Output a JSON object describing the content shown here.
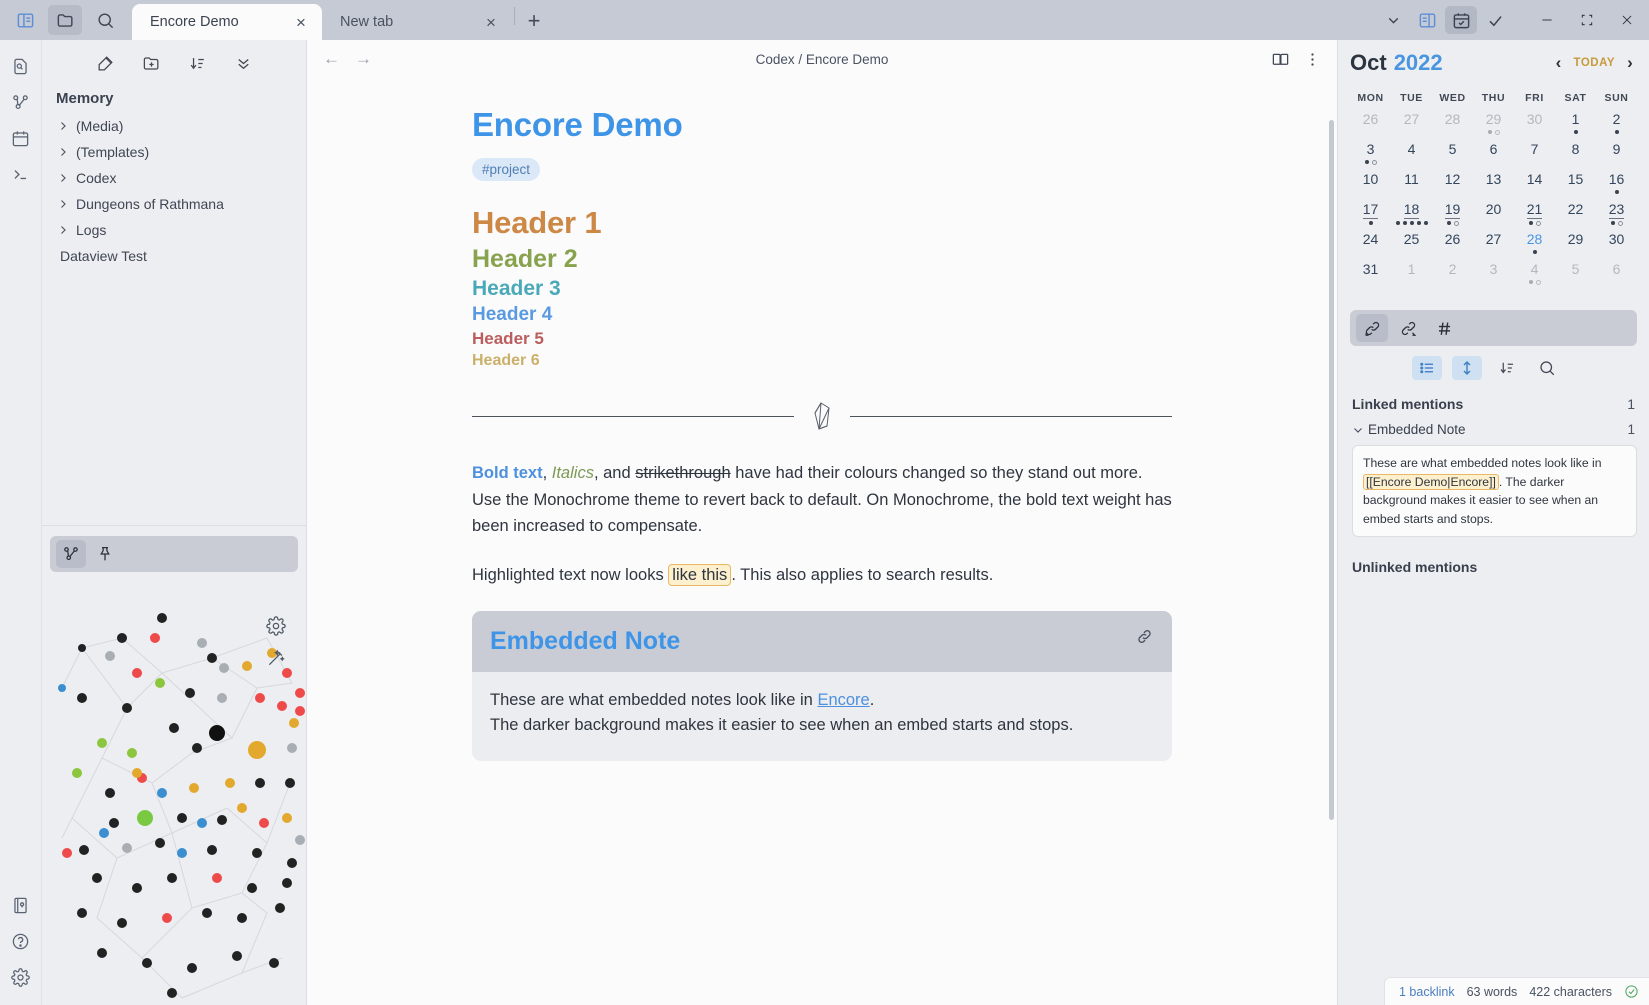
{
  "titlebar": {
    "left_icons": [
      {
        "name": "toggle-left-sidebar-icon",
        "glyph": "sidebar"
      },
      {
        "name": "vault-switcher-icon",
        "glyph": "folder"
      },
      {
        "name": "search-icon",
        "glyph": "search"
      }
    ],
    "tabs": [
      {
        "label": "Encore Demo",
        "active": true,
        "close": "×"
      },
      {
        "label": "New tab",
        "active": false,
        "close": "×"
      }
    ],
    "new_tab_glyph": "+",
    "right_icons": [
      {
        "name": "tab-list-chevron-icon",
        "glyph": "chevron-down"
      },
      {
        "name": "toggle-right-sidebar-icon",
        "glyph": "right-sidebar"
      },
      {
        "name": "calendar-plugin-icon",
        "glyph": "calendar-check",
        "active": true
      },
      {
        "name": "tasks-plugin-icon",
        "glyph": "check"
      }
    ],
    "window_controls": [
      {
        "name": "minimize-button",
        "glyph": "—"
      },
      {
        "name": "maximize-button",
        "glyph": "⬚"
      },
      {
        "name": "close-button",
        "glyph": "✕"
      }
    ]
  },
  "ribbon": {
    "top_items": [
      {
        "name": "quick-switcher-icon"
      },
      {
        "name": "graph-view-icon"
      },
      {
        "name": "calendar-icon"
      },
      {
        "name": "terminal-icon"
      }
    ],
    "bottom_items": [
      {
        "name": "vault-icon"
      },
      {
        "name": "help-icon"
      },
      {
        "name": "settings-icon"
      }
    ]
  },
  "sidebar": {
    "toolbar": [
      {
        "name": "new-note-icon"
      },
      {
        "name": "new-folder-icon"
      },
      {
        "name": "sort-order-icon"
      },
      {
        "name": "collapse-all-icon"
      }
    ],
    "vault_name": "Memory",
    "tree": [
      {
        "label": "(Media)",
        "folder": true
      },
      {
        "label": "(Templates)",
        "folder": true
      },
      {
        "label": "Codex",
        "folder": true
      },
      {
        "label": "Dungeons of Rathmana",
        "folder": true
      },
      {
        "label": "Logs",
        "folder": true
      },
      {
        "label": "Dataview Test",
        "folder": false
      }
    ],
    "graph_panel": {
      "tabs": [
        {
          "name": "local-graph-icon",
          "active": true
        },
        {
          "name": "pin-icon",
          "active": false
        }
      ],
      "controls": [
        {
          "name": "graph-settings-gear-icon"
        },
        {
          "name": "graph-style-wand-icon"
        }
      ]
    }
  },
  "note": {
    "nav": {
      "back": "←",
      "forward": "→"
    },
    "breadcrumb": "Codex / Encore Demo",
    "header_icons": [
      {
        "name": "reading-view-icon"
      },
      {
        "name": "more-options-icon"
      }
    ],
    "title": "Encore Demo",
    "tag": "#project",
    "headers": [
      {
        "level": 1,
        "text": "Header 1"
      },
      {
        "level": 2,
        "text": "Header 2"
      },
      {
        "level": 3,
        "text": "Header 3"
      },
      {
        "level": 4,
        "text": "Header 4"
      },
      {
        "level": 5,
        "text": "Header 5"
      },
      {
        "level": 6,
        "text": "Header 6"
      }
    ],
    "paragraph1": {
      "bold": "Bold text",
      "sep1": ", ",
      "italic": "Italics",
      "sep2": ", and ",
      "strike": "strikethrough",
      "rest": " have had their colours changed so they stand out more. Use the Monochrome theme to revert back to default. On Monochrome, the bold text weight has been increased to compensate."
    },
    "paragraph2": {
      "before": "Highlighted text now looks ",
      "highlight": "like this",
      "after": ". This also applies to search results."
    },
    "embed": {
      "title": "Embedded Note",
      "line1_before": "These are what embedded notes look like in ",
      "line1_link": "Encore",
      "line1_after": ".",
      "line2": "The darker background makes it easier to see when an embed starts and stops.",
      "link_icon": "embed-link-icon"
    }
  },
  "calendar": {
    "month": "Oct",
    "year": "2022",
    "prev": "‹",
    "today_label": "TODAY",
    "next": "›",
    "weekdays": [
      "MON",
      "TUE",
      "WED",
      "THU",
      "FRI",
      "SAT",
      "SUN"
    ],
    "weeks": [
      [
        {
          "n": "26",
          "dim": true,
          "dots": []
        },
        {
          "n": "27",
          "dim": true,
          "dots": []
        },
        {
          "n": "28",
          "dim": true,
          "dots": []
        },
        {
          "n": "29",
          "dim": true,
          "dots": [
            "gray",
            "gray-hollow"
          ]
        },
        {
          "n": "30",
          "dim": true,
          "dots": []
        },
        {
          "n": "1",
          "dots": [
            "solid"
          ]
        },
        {
          "n": "2",
          "dots": [
            "solid"
          ]
        }
      ],
      [
        {
          "n": "3",
          "dots": [
            "solid",
            "hollow"
          ]
        },
        {
          "n": "4",
          "dots": []
        },
        {
          "n": "5",
          "dots": []
        },
        {
          "n": "6",
          "dots": []
        },
        {
          "n": "7",
          "dots": []
        },
        {
          "n": "8",
          "dots": []
        },
        {
          "n": "9",
          "dots": []
        }
      ],
      [
        {
          "n": "10",
          "dots": []
        },
        {
          "n": "11",
          "dots": []
        },
        {
          "n": "12",
          "dots": []
        },
        {
          "n": "13",
          "dots": []
        },
        {
          "n": "14",
          "dots": []
        },
        {
          "n": "15",
          "dots": []
        },
        {
          "n": "16",
          "dots": [
            "solid"
          ]
        }
      ],
      [
        {
          "n": "17",
          "underline": true,
          "dots": [
            "solid"
          ]
        },
        {
          "n": "18",
          "underline": true,
          "dots": [
            "solid",
            "solid",
            "solid",
            "solid",
            "solid"
          ]
        },
        {
          "n": "19",
          "underline": true,
          "dots": [
            "solid",
            "hollow"
          ]
        },
        {
          "n": "20",
          "dots": []
        },
        {
          "n": "21",
          "underline": true,
          "dots": [
            "solid",
            "hollow"
          ]
        },
        {
          "n": "22",
          "dots": []
        },
        {
          "n": "23",
          "underline": true,
          "dots": [
            "solid",
            "hollow"
          ]
        }
      ],
      [
        {
          "n": "24",
          "dots": []
        },
        {
          "n": "25",
          "dots": []
        },
        {
          "n": "26",
          "dots": []
        },
        {
          "n": "27",
          "dots": []
        },
        {
          "n": "28",
          "today": true,
          "dots": [
            "solid"
          ]
        },
        {
          "n": "29",
          "dots": []
        },
        {
          "n": "30",
          "dots": []
        }
      ],
      [
        {
          "n": "31",
          "dots": []
        },
        {
          "n": "1",
          "dim": true,
          "dots": []
        },
        {
          "n": "2",
          "dim": true,
          "dots": []
        },
        {
          "n": "3",
          "dim": true,
          "dots": []
        },
        {
          "n": "4",
          "dim": true,
          "dots": [
            "gray",
            "gray-hollow"
          ]
        },
        {
          "n": "5",
          "dim": true,
          "dots": []
        },
        {
          "n": "6",
          "dim": true,
          "dots": []
        }
      ]
    ]
  },
  "backlinks": {
    "tabs": [
      {
        "name": "backlinks-icon",
        "active": true
      },
      {
        "name": "outgoing-links-icon",
        "active": false
      },
      {
        "name": "tags-icon",
        "active": false
      }
    ],
    "tools": [
      {
        "name": "show-more-context-icon",
        "on": true
      },
      {
        "name": "collapse-results-icon",
        "on": true
      },
      {
        "name": "sort-order-icon",
        "on": false
      },
      {
        "name": "search-icon",
        "on": false
      }
    ],
    "linked_label": "Linked mentions",
    "linked_count": "1",
    "group_label": "Embedded Note",
    "group_count": "1",
    "snippet": {
      "line1": "These are what embedded notes look like in",
      "ref": "[[Encore Demo|Encore]]",
      "ref_after": ".",
      "line2": "The darker background makes it easier to see when an embed starts and stops."
    },
    "unlinked_label": "Unlinked mentions"
  },
  "statusbar": {
    "backlink": "1 backlink",
    "words": "63 words",
    "characters": "422 characters",
    "sync_icon": "sync-ok-icon"
  },
  "colors": {
    "accent": "#4a95e0",
    "h1": "#cc8844",
    "h2": "#89a24d",
    "h3": "#4aa9b8",
    "h4": "#5a9be0",
    "h5": "#bb5d5d",
    "h6": "#cbb06a",
    "highlight_bg": "#fdf0cf",
    "highlight_border": "#e8b864",
    "today": "#c79a3d"
  }
}
